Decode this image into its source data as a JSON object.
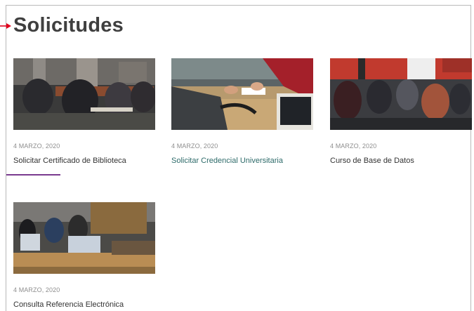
{
  "section": {
    "title": "Solicitudes"
  },
  "cards": [
    {
      "date": "4 MARZO, 2020",
      "label": "Solicitar Certificado de Biblioteca",
      "image": "students-at-library-tables-photo"
    },
    {
      "date": "4 MARZO, 2020",
      "label": "Solicitar Credencial Universitaria",
      "image": "card-handover-at-desk-photo"
    },
    {
      "date": "4 MARZO, 2020",
      "label": "Curso de Base de Datos",
      "image": "computer-lab-students-photo"
    },
    {
      "date": "4 MARZO, 2020",
      "label": "Consulta Referencia Electrónica",
      "image": "computer-room-users-photo"
    }
  ],
  "colors": {
    "accent_arrow": "#e0001b",
    "marker_line": "#7a3b8f",
    "link_accent": "#2e6b6a"
  }
}
